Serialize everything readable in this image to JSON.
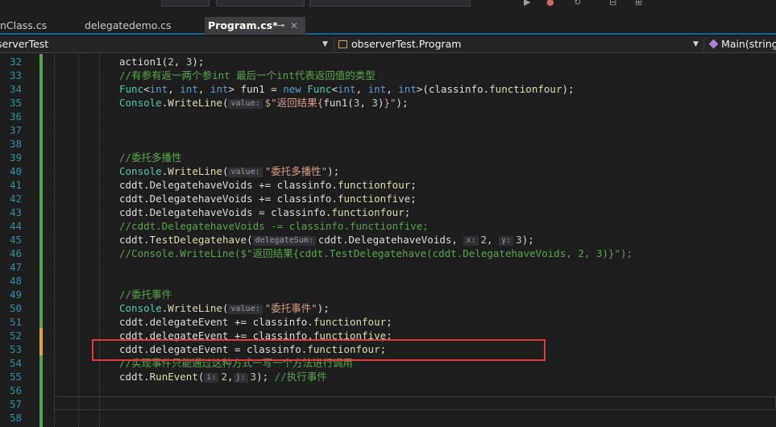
{
  "tabs": [
    {
      "label": "nClass.cs",
      "active": false
    },
    {
      "label": "delegatedemo.cs",
      "active": false
    },
    {
      "label": "Program.cs*",
      "active": true
    }
  ],
  "tab_pin_glyph": "⊸",
  "tab_close_glyph": "✕",
  "nav": {
    "project": "serverTest",
    "class": "observerTest.Program",
    "member": "Main(string["
  },
  "colors": {
    "changebar_saved": "#56a64b",
    "changebar_unsaved": "#e5a43a",
    "annotation_box": "#e03a3a"
  },
  "code_lines": [
    {
      "num": "32",
      "tokens": [
        {
          "t": "action1(",
          "c": "plain"
        },
        {
          "t": "2",
          "c": "num"
        },
        {
          "t": ", ",
          "c": "plain"
        },
        {
          "t": "3",
          "c": "num"
        },
        {
          "t": ");",
          "c": "plain"
        }
      ]
    },
    {
      "num": "33",
      "tokens": [
        {
          "t": "//有参有返一两个参int 最后一个int代表返回值的类型",
          "c": "comment"
        }
      ]
    },
    {
      "num": "34",
      "tokens": [
        {
          "t": "Func",
          "c": "type"
        },
        {
          "t": "<",
          "c": "plain"
        },
        {
          "t": "int",
          "c": "kw"
        },
        {
          "t": ", ",
          "c": "plain"
        },
        {
          "t": "int",
          "c": "kw"
        },
        {
          "t": ", ",
          "c": "plain"
        },
        {
          "t": "int",
          "c": "kw"
        },
        {
          "t": "> fun1 = ",
          "c": "plain"
        },
        {
          "t": "new",
          "c": "kw"
        },
        {
          "t": " ",
          "c": "plain"
        },
        {
          "t": "Func",
          "c": "type"
        },
        {
          "t": "<",
          "c": "plain"
        },
        {
          "t": "int",
          "c": "kw"
        },
        {
          "t": ", ",
          "c": "plain"
        },
        {
          "t": "int",
          "c": "kw"
        },
        {
          "t": ", ",
          "c": "plain"
        },
        {
          "t": "int",
          "c": "kw"
        },
        {
          "t": ">(classinfo.",
          "c": "plain"
        },
        {
          "t": "functionfour",
          "c": "method"
        },
        {
          "t": ");",
          "c": "plain"
        }
      ]
    },
    {
      "num": "35",
      "tokens": [
        {
          "t": "Console",
          "c": "type"
        },
        {
          "t": ".",
          "c": "plain"
        },
        {
          "t": "WriteLine",
          "c": "method"
        },
        {
          "t": "(",
          "c": "plain"
        },
        {
          "t": "value:",
          "c": "hint"
        },
        {
          "t": "$\"返回结果{",
          "c": "str"
        },
        {
          "t": "fun1(",
          "c": "plain"
        },
        {
          "t": "3",
          "c": "num"
        },
        {
          "t": ", ",
          "c": "plain"
        },
        {
          "t": "3",
          "c": "num"
        },
        {
          "t": ")",
          "c": "plain"
        },
        {
          "t": "}\"",
          "c": "str"
        },
        {
          "t": ");",
          "c": "plain"
        }
      ]
    },
    {
      "num": "36",
      "tokens": []
    },
    {
      "num": "37",
      "tokens": []
    },
    {
      "num": "38",
      "tokens": []
    },
    {
      "num": "39",
      "tokens": [
        {
          "t": "//委托多播性",
          "c": "comment"
        }
      ]
    },
    {
      "num": "40",
      "tokens": [
        {
          "t": "Console",
          "c": "type"
        },
        {
          "t": ".",
          "c": "plain"
        },
        {
          "t": "WriteLine",
          "c": "method"
        },
        {
          "t": "(",
          "c": "plain"
        },
        {
          "t": "value:",
          "c": "hint"
        },
        {
          "t": "\"委托多播性\"",
          "c": "str"
        },
        {
          "t": ");",
          "c": "plain"
        }
      ]
    },
    {
      "num": "41",
      "tokens": [
        {
          "t": "cddt.DelegatehaveVoids += classinfo.",
          "c": "plain"
        },
        {
          "t": "functionfour",
          "c": "method"
        },
        {
          "t": ";",
          "c": "plain"
        }
      ]
    },
    {
      "num": "42",
      "tokens": [
        {
          "t": "cddt.DelegatehaveVoids += classinfo.",
          "c": "plain"
        },
        {
          "t": "functionfive",
          "c": "method"
        },
        {
          "t": ";",
          "c": "plain"
        }
      ]
    },
    {
      "num": "43",
      "tokens": [
        {
          "t": "cddt.DelegatehaveVoids = classinfo.",
          "c": "plain"
        },
        {
          "t": "functionfour",
          "c": "method"
        },
        {
          "t": ";",
          "c": "plain"
        }
      ]
    },
    {
      "num": "44",
      "tokens": [
        {
          "t": "//cddt.DelegatehaveVoids -= classinfo.functionfive;",
          "c": "comment"
        }
      ]
    },
    {
      "num": "45",
      "tokens": [
        {
          "t": "cddt.",
          "c": "plain"
        },
        {
          "t": "TestDelegatehave",
          "c": "method"
        },
        {
          "t": "(",
          "c": "plain"
        },
        {
          "t": "delegateSum:",
          "c": "hint"
        },
        {
          "t": "cddt.DelegatehaveVoids, ",
          "c": "plain"
        },
        {
          "t": "x:",
          "c": "hint"
        },
        {
          "t": "2",
          "c": "num"
        },
        {
          "t": ", ",
          "c": "plain"
        },
        {
          "t": "y:",
          "c": "hint"
        },
        {
          "t": "3",
          "c": "num"
        },
        {
          "t": ");",
          "c": "plain"
        }
      ]
    },
    {
      "num": "46",
      "tokens": [
        {
          "t": "//Console.WriteLine($\"返回结果{cddt.TestDelegatehave(cddt.DelegatehaveVoids, 2, 3)}\");",
          "c": "comment"
        }
      ]
    },
    {
      "num": "47",
      "tokens": []
    },
    {
      "num": "48",
      "tokens": []
    },
    {
      "num": "49",
      "tokens": [
        {
          "t": "//委托事件",
          "c": "comment"
        }
      ]
    },
    {
      "num": "50",
      "tokens": [
        {
          "t": "Console",
          "c": "type"
        },
        {
          "t": ".",
          "c": "plain"
        },
        {
          "t": "WriteLine",
          "c": "method"
        },
        {
          "t": "(",
          "c": "plain"
        },
        {
          "t": "value:",
          "c": "hint"
        },
        {
          "t": "\"委托事件\"",
          "c": "str"
        },
        {
          "t": ");",
          "c": "plain"
        }
      ]
    },
    {
      "num": "51",
      "tokens": [
        {
          "t": "cddt.delegateEvent += classinfo.",
          "c": "plain"
        },
        {
          "t": "functionfour",
          "c": "method"
        },
        {
          "t": ";",
          "c": "plain"
        }
      ]
    },
    {
      "num": "52",
      "tokens": [
        {
          "t": "cddt.delegateEvent += classinfo.",
          "c": "plain"
        },
        {
          "t": "functionfive",
          "c": "method"
        },
        {
          "t": ";",
          "c": "plain"
        }
      ]
    },
    {
      "num": "53",
      "tokens": [
        {
          "t": "cddt.delegateEvent = classinfo.",
          "c": "plain"
        },
        {
          "t": "functionfour",
          "c": "method"
        },
        {
          "t": ";",
          "c": "plain"
        }
      ]
    },
    {
      "num": "54",
      "tokens": [
        {
          "t": "//实现事件只能通过这种方式一写一个方法进行调用",
          "c": "comment"
        }
      ]
    },
    {
      "num": "55",
      "tokens": [
        {
          "t": "cddt.",
          "c": "plain"
        },
        {
          "t": "RunEvent",
          "c": "method"
        },
        {
          "t": "(",
          "c": "plain"
        },
        {
          "t": "i:",
          "c": "hint"
        },
        {
          "t": "2",
          "c": "num"
        },
        {
          "t": ",",
          "c": "plain"
        },
        {
          "t": "j:",
          "c": "hint"
        },
        {
          "t": "3",
          "c": "num"
        },
        {
          "t": "); ",
          "c": "plain"
        },
        {
          "t": "//执行事件",
          "c": "comment"
        }
      ]
    },
    {
      "num": "56",
      "tokens": []
    },
    {
      "num": "57",
      "tokens": []
    },
    {
      "num": "58",
      "tokens": []
    }
  ]
}
